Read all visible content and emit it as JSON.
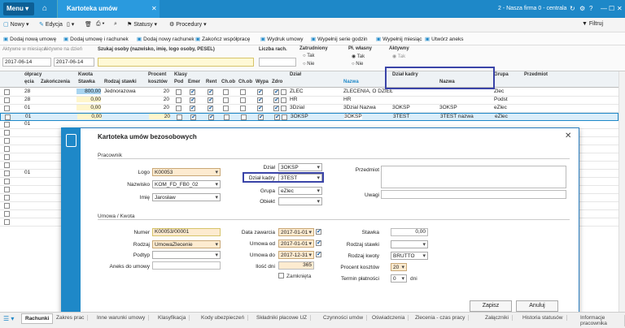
{
  "titlebar": {
    "menu": "Menu",
    "app_tab": "Kartoteka umów",
    "firm": "2 - Nasza firma 0 - centrala"
  },
  "toolbar1": {
    "new": "Nowy",
    "edit": "Edycja",
    "statuses": "Statusy",
    "procedures": "Procedury",
    "filter": "Filtruj"
  },
  "toolbar2": {
    "add_contract": "Dodaj nową umowę",
    "add_contract_bill": "Dodaj umowę i rachunek",
    "add_bill": "Dodaj nowy rachunek",
    "end_coop": "Zakończ współpracę",
    "print_contracts": "Wydruk umowy",
    "fill_hours": "Wypełnij serie godzin",
    "fill_month": "Wypełnij miesiąc",
    "create_annex": "Utwórz aneks"
  },
  "filters": {
    "active_month": "Aktywne w miesiącu",
    "active_day": "Aktywne na dzień",
    "date1": "2017-06-14",
    "date2": "2017-06-14",
    "search_label": "Szukaj osoby (nazwisko, imię, logo osoby, PESEL)",
    "count_label": "Liczba rach.",
    "zatrudniony": "Zatrudniony",
    "tak": "Tak",
    "nie": "Nie",
    "pl_wlasny": "Pł. własny",
    "aktywny": "Aktywny"
  },
  "grid": {
    "headers": {
      "wspolpracy": "ółpracy",
      "poczatek": "ęcia",
      "zakonczenie": "Zakończenia",
      "kwota": "Kwota",
      "stawka": "Stawka",
      "rodzaj": "Rodzaj stawki",
      "procent": "Procent",
      "kosztow": "kosztów",
      "klasy": "Klasy",
      "pod": "Pod",
      "emer": "Emer",
      "rent": "Rent",
      "chob": "Ch.ob",
      "chob2": "Ch.ob",
      "wypa": "Wypa",
      "zdro": "Zdro",
      "dzial": "Dział",
      "nazwa": "Nazwa",
      "dzial_kadry": "Dział kadry",
      "nazwa2": "Nazwa",
      "grupa": "Grupa",
      "przedmiot": "Przedmiot"
    },
    "rows": [
      {
        "c1": "28",
        "stawka": "800,00",
        "rodzaj": "Jednorazowa",
        "proc": "20",
        "dzial": "ZLEC",
        "nazwa": "ZLECENIA, O DZIEŁ",
        "kadry": "",
        "kadry_n": "",
        "grupa": "Zlec"
      },
      {
        "c1": "28",
        "stawka": "0,00",
        "rodzaj": "",
        "proc": "20",
        "dzial": "HR",
        "nazwa": "HR",
        "kadry": "",
        "kadry_n": "",
        "grupa": "Podst"
      },
      {
        "c1": "01",
        "stawka": "0,00",
        "rodzaj": "",
        "proc": "20",
        "dzial": "3Dzial",
        "nazwa": "3Dzial Nazwa",
        "kadry": "3OKSP",
        "kadry_n": "3OKSP",
        "grupa": "eZlec"
      },
      {
        "c1": "01",
        "stawka": "0,00",
        "rodzaj": "",
        "proc": "20",
        "dzial": "3OKSP",
        "nazwa": "3OKSP",
        "kadry": "3TEST",
        "kadry_n": "3TEST nazwa",
        "grupa": "eZlec"
      },
      {
        "c1": "01",
        "stawka": "",
        "rodzaj": "",
        "proc": "",
        "dzial": "",
        "nazwa": "",
        "kadry": "",
        "kadry_n": "",
        "grupa": ""
      }
    ]
  },
  "dialog": {
    "title": "Kartoteka umów bezosobowych",
    "pracownik": "Pracownik",
    "logo_l": "Logo",
    "logo_v": "K00053",
    "nazwisko_l": "Nazwisko",
    "nazwisko_v": "KOM_FD_FB0_02",
    "imie_l": "Imię",
    "imie_v": "Jarosław",
    "dzial_l": "Dział",
    "dzial_v": "3OKSP",
    "kadry_l": "Dział kadry",
    "kadry_v": "3TEST",
    "grupa_l": "Grupa",
    "grupa_v": "eZlec",
    "obiekt_l": "Obiekt",
    "przedmiot_l": "Przedmiot",
    "uwagi_l": "Uwagi",
    "umowa": "Umowa / Kwota",
    "numer_l": "Numer",
    "numer_v": "K00053/00001",
    "rodzaj_l": "Rodzaj",
    "rodzaj_v": "UmowaZlecenie",
    "podtyp_l": "Podtyp",
    "aneks_l": "Aneks do umowy",
    "data_zaw_l": "Data zawarcia",
    "data_zaw_v": "2017-01-01",
    "umowa_od_l": "Umowa od",
    "umowa_od_v": "2017-01-01",
    "umowa_do_l": "Umowa do",
    "umowa_do_v": "2017-12-31",
    "ilosc_l": "Ilość dni",
    "ilosc_v": "365",
    "zamknieta": "Zamknięta",
    "stawka_l": "Stawka",
    "stawka_v": "0,00",
    "rodzaj_st_l": "Rodzaj stawki",
    "rodzaj_kw_l": "Rodzaj kwoty",
    "rodzaj_kw_v": "BRUTTO",
    "procent_l": "Procent kosztów",
    "procent_v": "20",
    "termin_l": "Termin płatności",
    "termin_v": "0",
    "dni": "dni",
    "save": "Zapisz",
    "cancel": "Anuluj"
  },
  "bottomtabs": [
    "Rachunki",
    "Zakres prac",
    "Inne warunki umowy",
    "Klasyfikacja",
    "Kody ubezpieczeń",
    "Składniki płacowe UZ",
    "Czynności umów",
    "Oświadczenia",
    "Zlecenia - czas pracy",
    "Załączniki",
    "Historia statusów",
    "Informacje pracownika"
  ]
}
